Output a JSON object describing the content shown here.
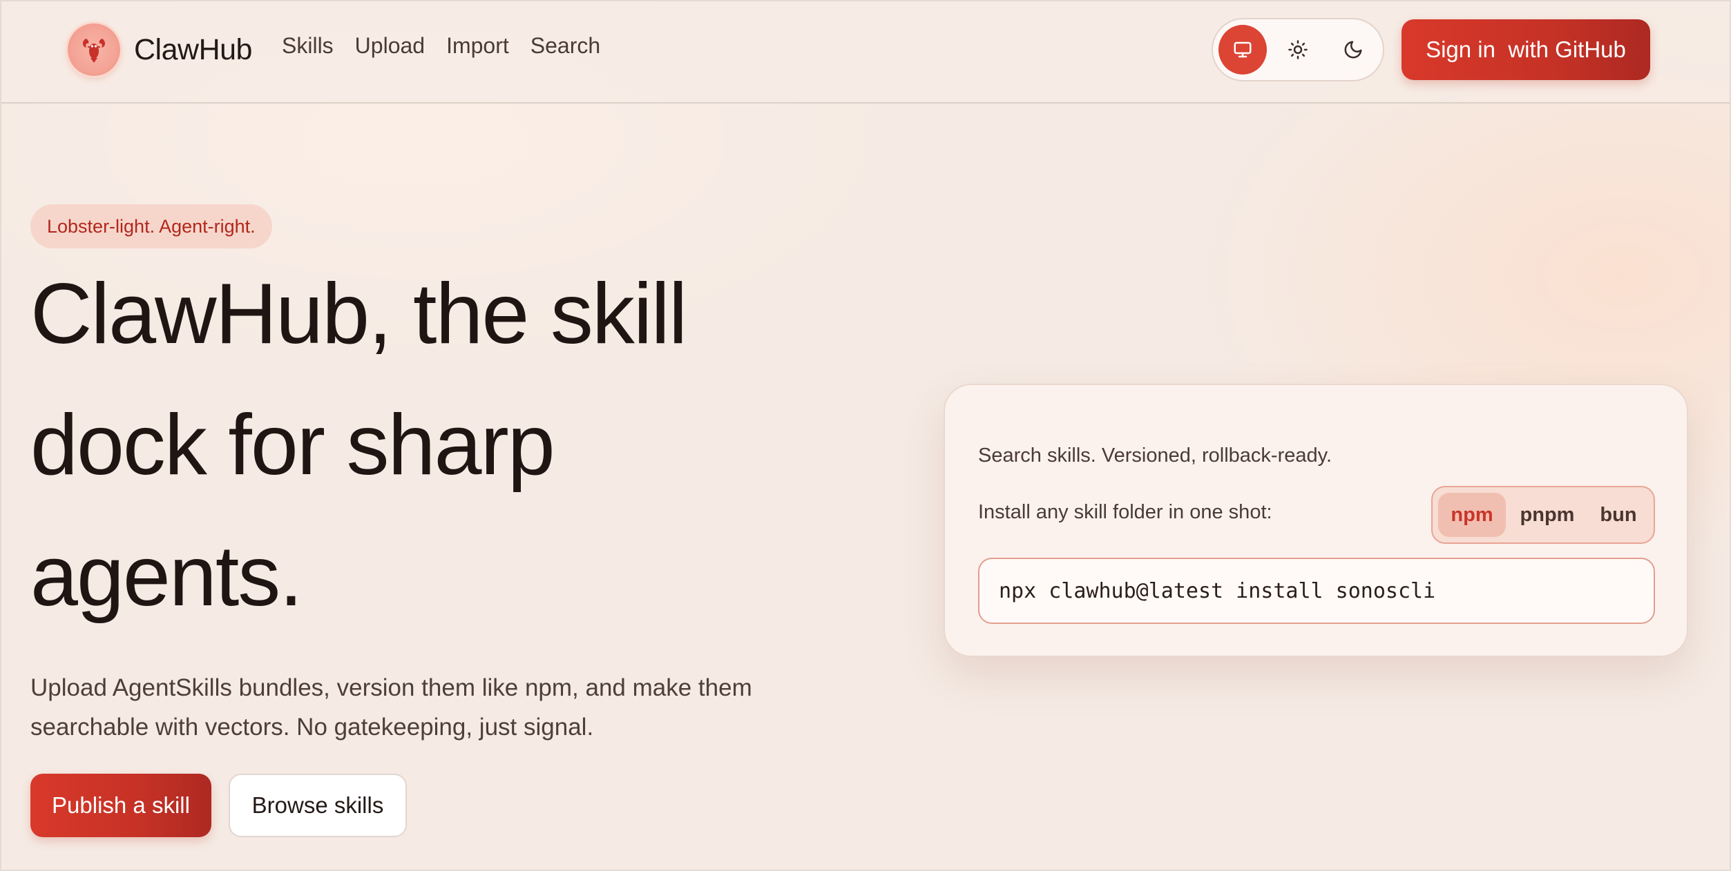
{
  "header": {
    "brand": "ClawHub",
    "nav": [
      "Skills",
      "Upload",
      "Import",
      "Search"
    ],
    "theme_options": [
      {
        "icon": "monitor-icon",
        "active": true
      },
      {
        "icon": "sun-icon",
        "active": false
      },
      {
        "icon": "moon-icon",
        "active": false
      }
    ],
    "signin_label": "Sign in  with GitHub"
  },
  "hero": {
    "tagline": "Lobster-light. Agent-right.",
    "title": "ClawHub, the skill dock for sharp agents.",
    "subtitle": "Upload AgentSkills bundles, version them like npm, and make them searchable with vectors. No gatekeeping, just signal.",
    "primary_cta": "Publish a skill",
    "secondary_cta": "Browse skills"
  },
  "install_card": {
    "title": "Search skills. Versioned, rollback-ready.",
    "label": "Install any skill folder in one shot:",
    "package_managers": [
      "npm",
      "pnpm",
      "bun"
    ],
    "selected_manager": "npm",
    "command": "npx clawhub@latest install sonoscli"
  },
  "colors": {
    "accent": "#dc4434",
    "accent_dark": "#ad2922",
    "background": "#f5ebe4",
    "text": "#231916"
  }
}
